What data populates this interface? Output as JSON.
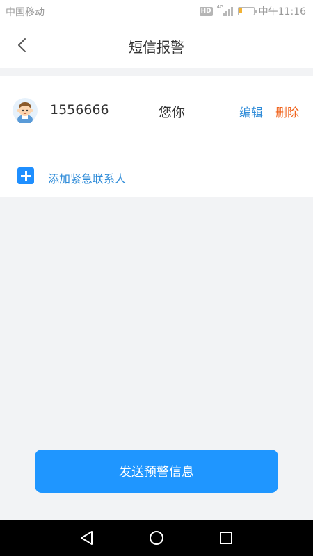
{
  "status_bar": {
    "carrier": "中国移动",
    "hd_badge": "HD",
    "network": "4G",
    "battery_level": 0.2,
    "time": "中午11:16"
  },
  "header": {
    "title": "短信报警",
    "back_icon": "chevron-left-icon"
  },
  "contacts": [
    {
      "phone": "1556666",
      "name": "您你",
      "edit_label": "编辑",
      "delete_label": "删除",
      "avatar_icon": "boy-avatar"
    }
  ],
  "add_contact": {
    "label": "添加紧急联系人",
    "icon": "plus-square-icon"
  },
  "send_button": {
    "label": "发送预警信息"
  },
  "nav_bar": {
    "back_icon": "triangle-back-icon",
    "home_icon": "circle-home-icon",
    "recents_icon": "square-recents-icon"
  },
  "colors": {
    "accent": "#1f96ff",
    "link_blue": "#2e8bd8",
    "delete_orange": "#f0641e",
    "background": "#f2f3f5"
  }
}
